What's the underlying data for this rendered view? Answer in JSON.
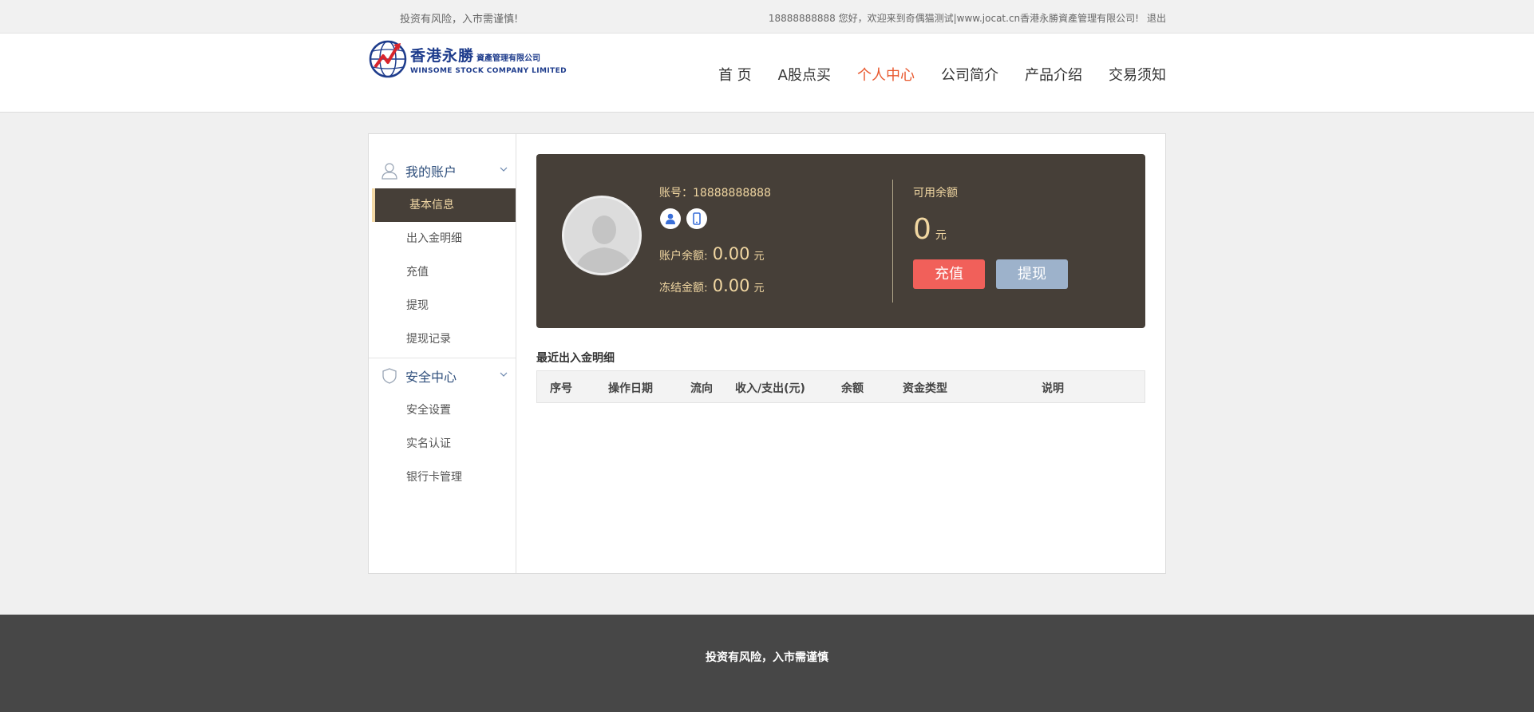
{
  "topbar": {
    "risk_notice": "投资有风险，入市需谨慎!",
    "welcome": "18888888888 您好，欢迎来到奇偶猫测试|www.jocat.cn香港永勝資產管理有限公司!",
    "logout": "退出"
  },
  "logo": {
    "cn_name": "香港永勝",
    "cn_sub": "資產管理有限公司",
    "en_name": "WINSOME STOCK COMPANY LIMITED"
  },
  "nav": [
    {
      "label": "首 页",
      "active": false
    },
    {
      "label": "A股点买",
      "active": false
    },
    {
      "label": "个人中心",
      "active": true
    },
    {
      "label": "公司简介",
      "active": false
    },
    {
      "label": "产品介绍",
      "active": false
    },
    {
      "label": "交易须知",
      "active": false
    }
  ],
  "sidebar": {
    "groups": [
      {
        "title": "我的账户",
        "icon": "user-icon",
        "items": [
          "基本信息",
          "出入金明细",
          "充值",
          "提现",
          "提现记录"
        ],
        "active_index": 0
      },
      {
        "title": "安全中心",
        "icon": "shield-icon",
        "items": [
          "安全设置",
          "实名认证",
          "银行卡管理"
        ]
      }
    ]
  },
  "account": {
    "account_label": "账号：18888888888",
    "balance_label": "账户余额:",
    "balance_value": "0.00",
    "frozen_label": "冻结金额:",
    "frozen_value": "0.00",
    "unit": "元",
    "available_label": "可用余额",
    "available_value": "0",
    "charge_button": "充值",
    "withdraw_button": "提现"
  },
  "recent": {
    "title": "最近出入金明细",
    "columns": [
      "序号",
      "操作日期",
      "流向",
      "收入/支出(元)",
      "余额",
      "资金类型",
      "说明"
    ]
  },
  "footer": {
    "text": "投资有风险，入市需谨慎"
  },
  "colors": {
    "accent": "#e8582e",
    "panel_bg": "#463f38",
    "gold_text": "#f1d7a2",
    "charge_btn": "#f1605a",
    "withdraw_btn": "#9db2cb",
    "footer_bg": "#474747"
  }
}
